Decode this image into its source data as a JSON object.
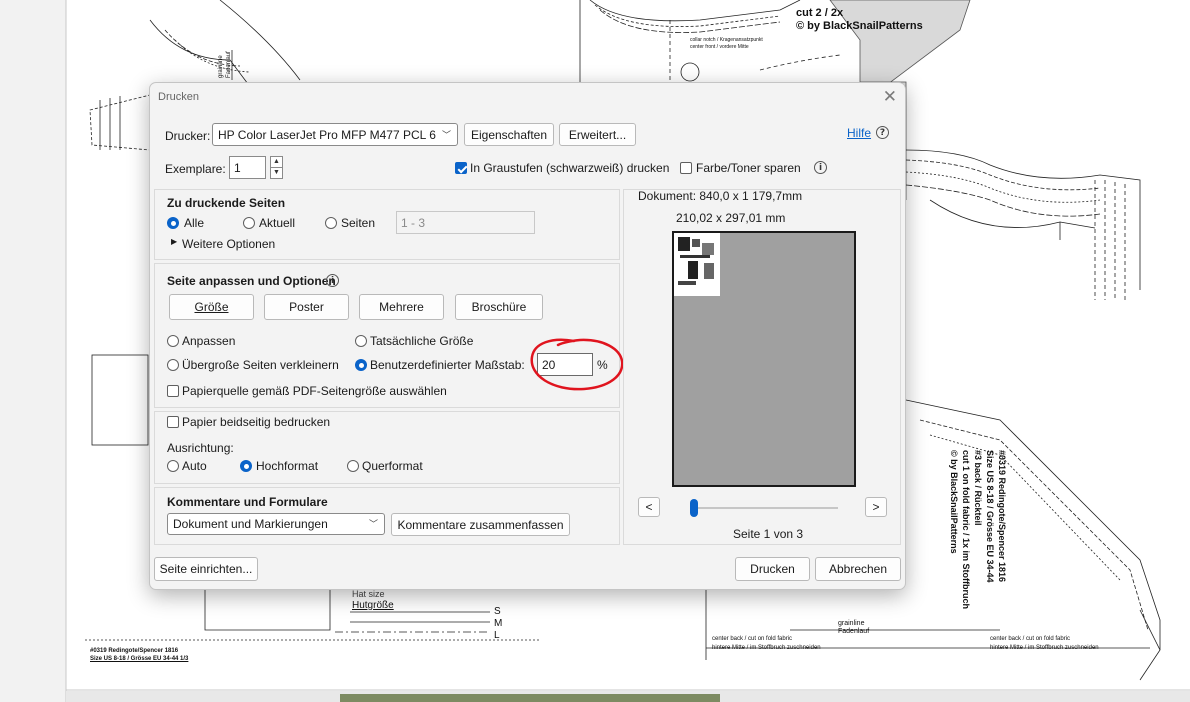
{
  "dialog": {
    "title": "Drucken",
    "close_icon": "close-icon",
    "printer_label": "Drucker:",
    "printer_value": "HP Color LaserJet Pro MFP M477 PCL 6",
    "properties_button": "Eigenschaften",
    "advanced_button": "Erweitert...",
    "help_link": "Hilfe",
    "copies_label": "Exemplare:",
    "copies_value": "1",
    "grayscale_label": "In Graustufen (schwarzweiß) drucken",
    "grayscale_checked": true,
    "save_toner_label": "Farbe/Toner sparen",
    "save_toner_checked": false,
    "pages": {
      "heading": "Zu druckende Seiten",
      "all": "Alle",
      "current": "Aktuell",
      "pages": "Seiten",
      "range_value": "1 - 3",
      "more_options": "Weitere Optionen",
      "selected": "all"
    },
    "fit": {
      "heading": "Seite anpassen und Optionen",
      "tabs": [
        "Größe",
        "Poster",
        "Mehrere",
        "Broschüre"
      ],
      "fit": "Anpassen",
      "actual": "Tatsächliche Größe",
      "shrink": "Übergroße Seiten verkleinern",
      "custom": "Benutzerdefinierter Maßstab:",
      "scale_value": "20",
      "percent": "%",
      "paper_source": "Papierquelle gemäß PDF-Seitengröße auswählen",
      "selected": "custom"
    },
    "duplex": {
      "label": "Papier beidseitig bedrucken",
      "orientation_label": "Ausrichtung:",
      "auto": "Auto",
      "portrait": "Hochformat",
      "landscape": "Querformat",
      "selected": "portrait"
    },
    "comments": {
      "heading": "Kommentare und Formulare",
      "select_value": "Dokument und Markierungen",
      "summarize_button": "Kommentare zusammenfassen"
    },
    "preview": {
      "document_size": "Dokument: 840,0 x 1 179,7mm",
      "page_size": "210,02 x 297,01 mm",
      "prev": "<",
      "next": ">",
      "page_indicator": "Seite 1 von 3",
      "slider_fraction": 0.0
    },
    "page_setup_button": "Seite einrichten...",
    "print_button": "Drucken",
    "cancel_button": "Abbrechen"
  },
  "background": {
    "label_cut": "cut 2 / 2x",
    "label_copyright_top": "© by BlackSnailPatterns",
    "label_collar1": "collar notch / Kragenansatzpunkt",
    "label_collar2": "center front / vordere Mitte",
    "label_grainline_left": "grainline",
    "label_fadenlauf_left": "Fadenlauf",
    "label_hutgroesse": "Hutgröße",
    "label_hat_size": "Hat size",
    "label_s": "S",
    "label_m": "M",
    "label_l": "L",
    "label_bottom_left1": "#0319 Redingote/Spencer 1816",
    "label_bottom_left2": "Size US 8-18 / Grösse EU 34-44 1/3",
    "label_vertical_1": "#0319 Redingote/Spencer 1816",
    "label_vertical_2": "Size US 8-18 / Grösse EU 34-44",
    "label_vertical_3": "#3 back / Rückteil",
    "label_vertical_4": "cut 1 on fold fabric / 1x im Stoffbruch",
    "label_vertical_5": "© by BlackSnailPatterns",
    "label_grainline_right": "grainline",
    "label_fadenlauf_right": "Fadenlauf",
    "label_cb1": "center back / cut on fold fabric",
    "label_cb2": "hintere Mitte / im Stoffbruch zuschneiden",
    "label_cb3": "center back / cut on fold fabric",
    "label_cb4": "hintere Mitte / im Stoffbruch zuschneiden",
    "annotation_color": "#e0141e",
    "accent_color": "#0a63c9"
  }
}
